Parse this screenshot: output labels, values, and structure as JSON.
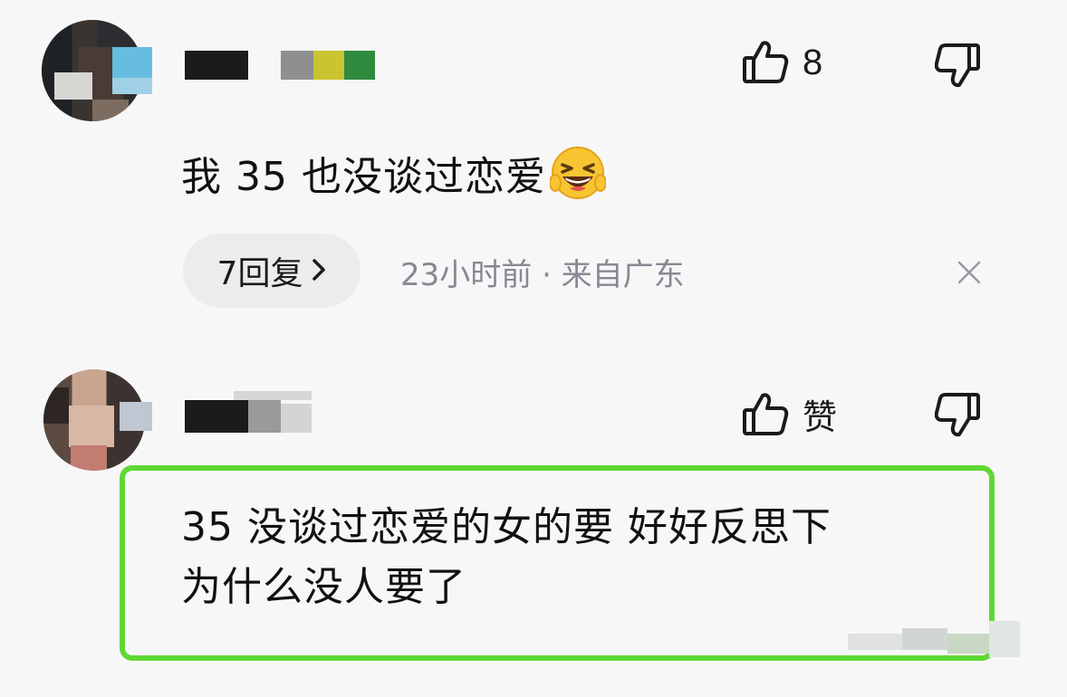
{
  "comments": [
    {
      "likes": "8",
      "text": "我 35 也没谈过恋爱",
      "emoji_icon": "grinning-squinting-face-emoji",
      "replies_label": "7回复",
      "meta": "23小时前 · 来自广东"
    },
    {
      "likes_label": "赞",
      "text_line1": "35 没谈过恋爱的女的要 好好反思下",
      "text_line2": "为什么没人要了"
    }
  ],
  "colors": {
    "highlight_border": "#5fd833",
    "meta_text": "#8a8794",
    "pill_background": "#ececee"
  }
}
